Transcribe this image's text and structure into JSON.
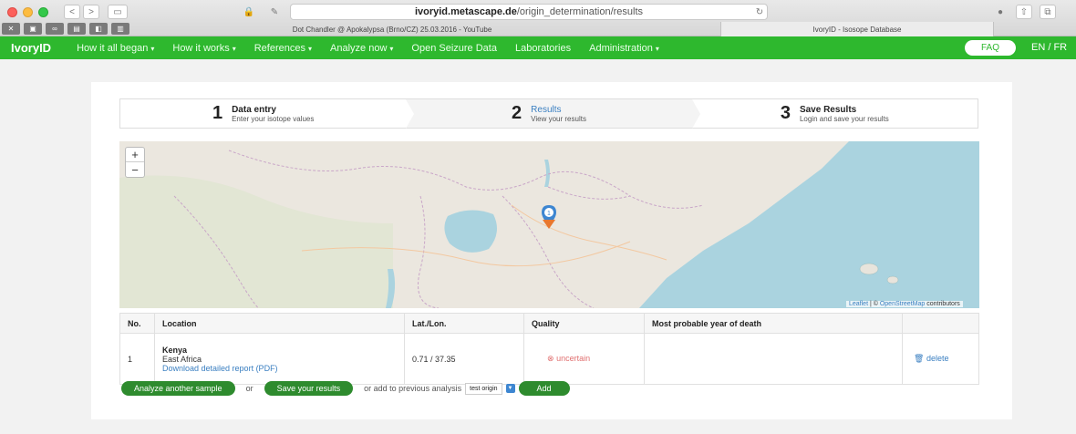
{
  "browser": {
    "url_host": "ivoryid.metascape.de",
    "url_path": "/origin_determination/results",
    "tabs": [
      {
        "label": "Dot Chandler @ Apokalypsa (Brno/CZ) 25.03.2016 - YouTube",
        "active": false
      },
      {
        "label": "IvoryID - Isosope Database",
        "active": true
      }
    ]
  },
  "nav": {
    "brand": "IvoryID",
    "items": [
      {
        "label": "How it all began",
        "dropdown": true
      },
      {
        "label": "How it works",
        "dropdown": true
      },
      {
        "label": "References",
        "dropdown": true
      },
      {
        "label": "Analyze now",
        "dropdown": true
      },
      {
        "label": "Open Seizure Data",
        "dropdown": false
      },
      {
        "label": "Laboratories",
        "dropdown": false
      },
      {
        "label": "Administration",
        "dropdown": true
      }
    ],
    "faq": "FAQ",
    "lang": "EN / FR"
  },
  "steps": [
    {
      "num": "1",
      "title": "Data entry",
      "sub": "Enter your isotope values",
      "active": false
    },
    {
      "num": "2",
      "title": "Results",
      "sub": "View your results",
      "active": true
    },
    {
      "num": "3",
      "title": "Save Results",
      "sub": "Login and save your results",
      "active": false
    }
  ],
  "map": {
    "zoom_in": "+",
    "zoom_out": "−",
    "marker_label": "1",
    "attribution_leaflet": "Leaflet",
    "attribution_sep": " | © ",
    "attribution_osm": "OpenStreetMap",
    "attribution_rest": " contributors"
  },
  "table": {
    "headers": [
      "No.",
      "Location",
      "Lat./Lon.",
      "Quality",
      "Most probable year of death",
      ""
    ],
    "rows": [
      {
        "no": "1",
        "location_name": "Kenya",
        "location_region": "East Africa",
        "report_link": "Download detailed report (PDF)",
        "latlon": "0.71 / 37.35",
        "quality": "uncertain",
        "year": "",
        "action": "delete"
      }
    ]
  },
  "actions": {
    "analyze_btn": "Analyze another sample",
    "or": "or",
    "save_btn": "Save your results",
    "add_text": "or add to previous analysis",
    "select_value": "test origin",
    "add_btn": "Add"
  },
  "colors": {
    "nav_green": "#2eb82e",
    "button_green": "#2e8b2e",
    "link_blue": "#3a7fc1",
    "uncertain_red": "#e07070",
    "marker_orange": "#e8772e",
    "marker_blue": "#3d86d1"
  }
}
